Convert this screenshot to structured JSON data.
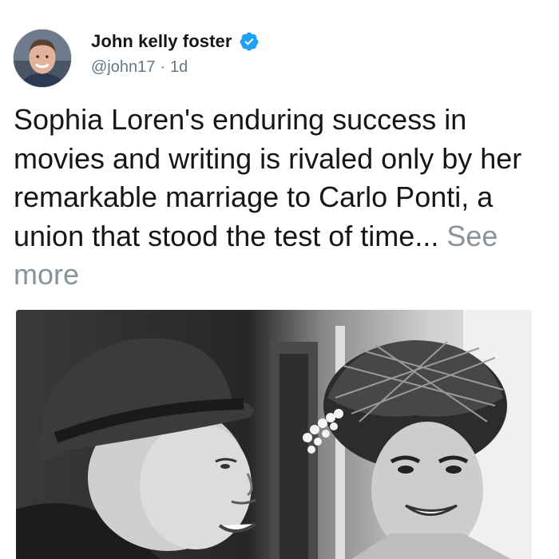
{
  "post": {
    "author": {
      "display_name": "John kelly foster",
      "handle": "@john17",
      "verified": true,
      "avatar_icon": "avatar-photo"
    },
    "separator": "·",
    "timestamp": "1d",
    "text": "Sophia Loren's enduring success in movies and writing is rivaled only by her remarkable marriage to Carlo Ponti, a union that stood the test of time...",
    "see_more_label": "See more",
    "media": {
      "type": "photo",
      "style": "black-and-white"
    }
  },
  "colors": {
    "primary_text": "#14171a",
    "secondary_text": "#657786",
    "see_more": "#8a9299",
    "verified_badge": "#1da1f2"
  }
}
